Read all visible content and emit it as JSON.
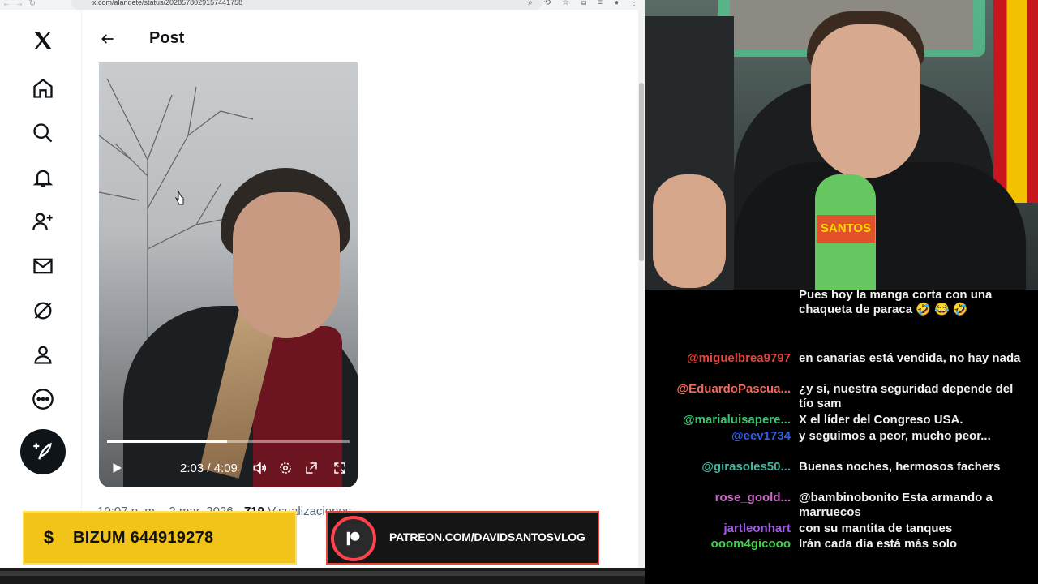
{
  "browser": {
    "url": "x.com/alandete/status/2028578029157441758",
    "post_header": "Post",
    "video": {
      "time": "2:03 / 4:09",
      "progress_fraction": 0.494
    },
    "meta": {
      "time": "10:07 p. m.",
      "sep1": "·",
      "date": "2 mar. 2026",
      "sep2": "·",
      "views_count": "719",
      "views_label": "Visualizaciones"
    }
  },
  "overlays": {
    "bizum": {
      "symbol": "$",
      "label": "BIZUM 644919278"
    },
    "patreon": {
      "label": "PATREON.COM/DAVIDSANTOSVLOG"
    }
  },
  "webcam": {
    "mic_label": "SANTOS"
  },
  "chat": [
    {
      "user": "",
      "text": "Pues hoy la manga corta con una chaqueta de paraca 🤣 😂 🤣",
      "color": "#e03a3a"
    },
    {
      "user": "@miguelbrea9797",
      "text": "en canarias está vendida, no hay nada",
      "color": "#e0453a"
    },
    {
      "user": "@EduardoPascua...",
      "text": "¿y si, nuestra seguridad depende del tío sam",
      "color": "#f06a5a"
    },
    {
      "user": "@marialuisapere...",
      "text": "X el líder del Congreso USA.",
      "color": "#3bc46c"
    },
    {
      "user": "@eev1734",
      "text": "y seguimos a peor, mucho peor...",
      "color": "#2f5fe0"
    },
    {
      "user": "@girasoles50...",
      "text": "Buenas noches, hermosos fachers",
      "color": "#45b4a0"
    },
    {
      "user": "rose_goold...",
      "text": "@bambinobonito Esta armando a marruecos",
      "color": "#c86ac8"
    },
    {
      "user": "jartleonhart",
      "text": "con su mantita de tanques",
      "color": "#a259e6"
    },
    {
      "user": "ooom4gicooo",
      "text": "Irán cada día está más solo",
      "color": "#3fd24a"
    }
  ]
}
